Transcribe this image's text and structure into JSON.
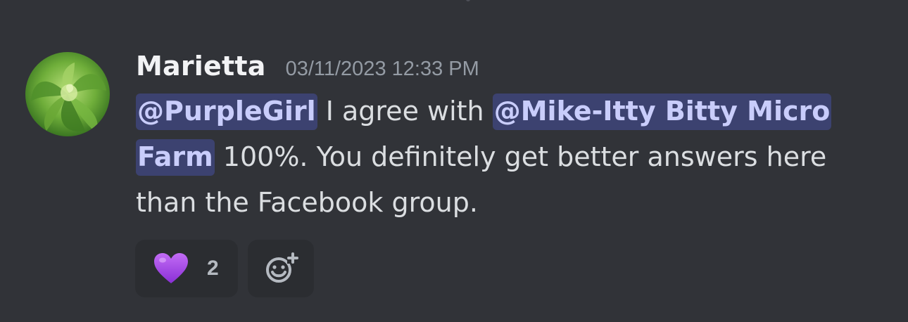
{
  "message": {
    "author": "Marietta",
    "timestamp": "03/11/2023 12:33 PM",
    "avatar_icon": "lettuce-avatar",
    "mention_1": "@PurpleGirl",
    "text_1": " I agree with ",
    "mention_2a": "@Mike-Itty Bitty Micro ",
    "mention_2b": "Farm",
    "text_2": " 100%. You definitely get better answers here",
    "text_3": "than the Facebook group."
  },
  "reactions": {
    "heart": {
      "emoji_icon": "purple-heart-icon",
      "count": "2"
    },
    "add": {
      "icon": "add-reaction-icon"
    }
  },
  "colors": {
    "background": "#313338",
    "mention_bg": "#3c4270",
    "mention_text": "#c9cdfb",
    "reaction_bg": "#2b2d31",
    "heart": "#a44ce8"
  }
}
